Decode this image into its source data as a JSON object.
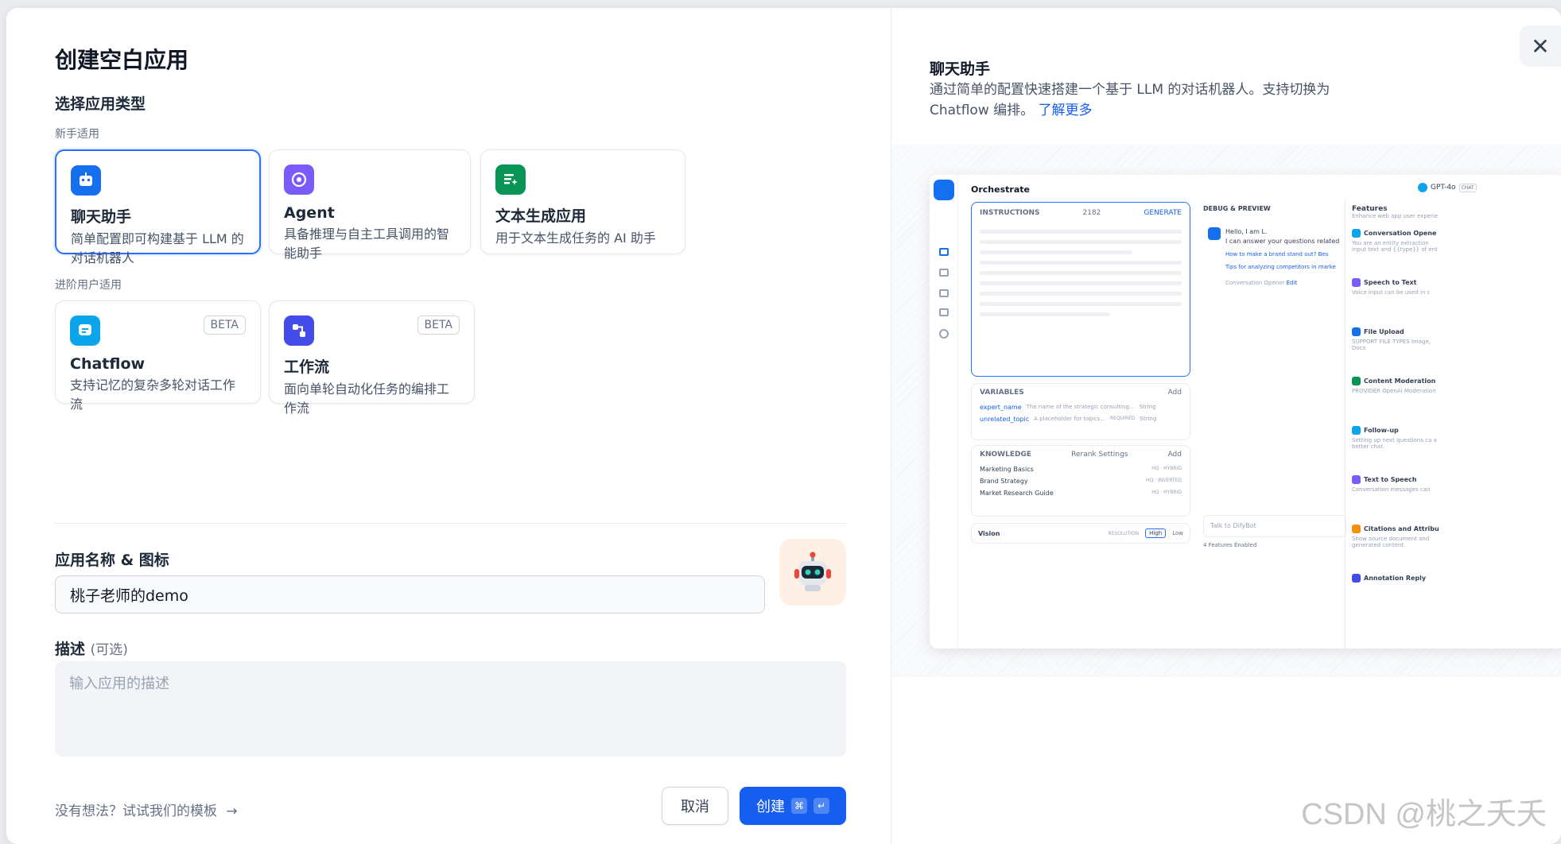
{
  "dialog": {
    "title": "创建空白应用",
    "type_section_title": "选择应用类型",
    "beginner_label": "新手适用",
    "advanced_label": "进阶用户适用",
    "name_section_title": "应用名称 & 图标",
    "name_value": "桃子老师的demo",
    "desc_section_title": "描述",
    "desc_optional": "(可选)",
    "desc_placeholder": "输入应用的描述",
    "template_link": "没有想法？试试我们的模板",
    "cancel_label": "取消",
    "create_label": "创建"
  },
  "app_types": [
    {
      "title": "聊天助手",
      "desc": "简单配置即可构建基于 LLM 的对话机器人",
      "color": "#1570ef",
      "icon": "chat-bot-icon",
      "selected": true
    },
    {
      "title": "Agent",
      "desc": "具备推理与自主工具调用的智能助手",
      "color": "#7a5af8",
      "icon": "agent-icon",
      "selected": false
    },
    {
      "title": "文本生成应用",
      "desc": "用于文本生成任务的 AI 助手",
      "color": "#079455",
      "icon": "text-generation-icon",
      "selected": false
    }
  ],
  "advanced_types": [
    {
      "title": "Chatflow",
      "desc": "支持记忆的复杂多轮对话工作流",
      "badge": "BETA",
      "color": "#0ba5ec",
      "icon": "chatflow-icon"
    },
    {
      "title": "工作流",
      "desc": "面向单轮自动化任务的编排工作流",
      "badge": "BETA",
      "color": "#444ce7",
      "icon": "workflow-icon"
    }
  ],
  "preview": {
    "title": "聊天助手",
    "desc": "通过简单的配置快速搭建一个基于 LLM 的对话机器人。支持切换为 Chatflow 编排。",
    "learn_more": "了解更多",
    "shot": {
      "header": "Orchestrate",
      "model": "GPT-4o",
      "model_tag": "CHAT",
      "instructions": "INSTRUCTIONS",
      "instr_count": "2182",
      "generate": "GENERATE",
      "variables": "VARIABLES",
      "add": "Add",
      "vars": [
        {
          "name": "expert_name",
          "desc": "The name of the strategic consulting...",
          "type": "String",
          "req": ""
        },
        {
          "name": "unrelated_topic",
          "desc": "A placeholder for topics...",
          "type": "String",
          "req": "REQUIRED"
        }
      ],
      "knowledge": "KNOWLEDGE",
      "rerank": "Rerank Settings",
      "kb": [
        {
          "name": "Marketing Basics",
          "tag": "HQ · HYBRID"
        },
        {
          "name": "Brand Strategy",
          "tag": "HQ · INVERTED"
        },
        {
          "name": "Market Research Guide",
          "tag": "HQ · HYBRID"
        }
      ],
      "vision": "Vision",
      "resolution": "RESOLUTION",
      "high": "High",
      "low": "Low",
      "debug": "DEBUG & PREVIEW",
      "hello": "Hello, I am L.",
      "hello2": "I can answer your questions related",
      "q1": "How to make a brand stand out?",
      "q1b": "Bes",
      "q2": "Tips for analyzing competitors in marke",
      "opener": "Conversation Opener",
      "edit": "Edit",
      "talk": "Talk to DifyBot",
      "features_enabled": "4 Features Enabled",
      "features_title": "Features",
      "features_sub": "Enhance web app user experie",
      "features": [
        {
          "name": "Conversation Opene",
          "desc": "You are an entity extraction input text and {{type}} of ent",
          "color": "#0ba5ec"
        },
        {
          "name": "Speech to Text",
          "desc": "Voice input can be used in c",
          "color": "#7a5af8"
        },
        {
          "name": "File Upload",
          "desc": "SUPPORT FILE TYPES  Image, Docs",
          "color": "#1570ef"
        },
        {
          "name": "Content Moderation",
          "desc": "PROVIDER  OpenAI Moderation",
          "color": "#079455"
        },
        {
          "name": "Follow-up",
          "desc": "Setting up next questions ca a better chat.",
          "color": "#0ba5ec"
        },
        {
          "name": "Text to Speech",
          "desc": "Conversation messages can",
          "color": "#7a5af8"
        },
        {
          "name": "Citations and Attribu",
          "desc": "Show source document and generated content.",
          "color": "#f79009"
        },
        {
          "name": "Annotation Reply",
          "desc": "",
          "color": "#444ce7"
        }
      ]
    }
  },
  "watermark": "CSDN @桃之夭夭"
}
